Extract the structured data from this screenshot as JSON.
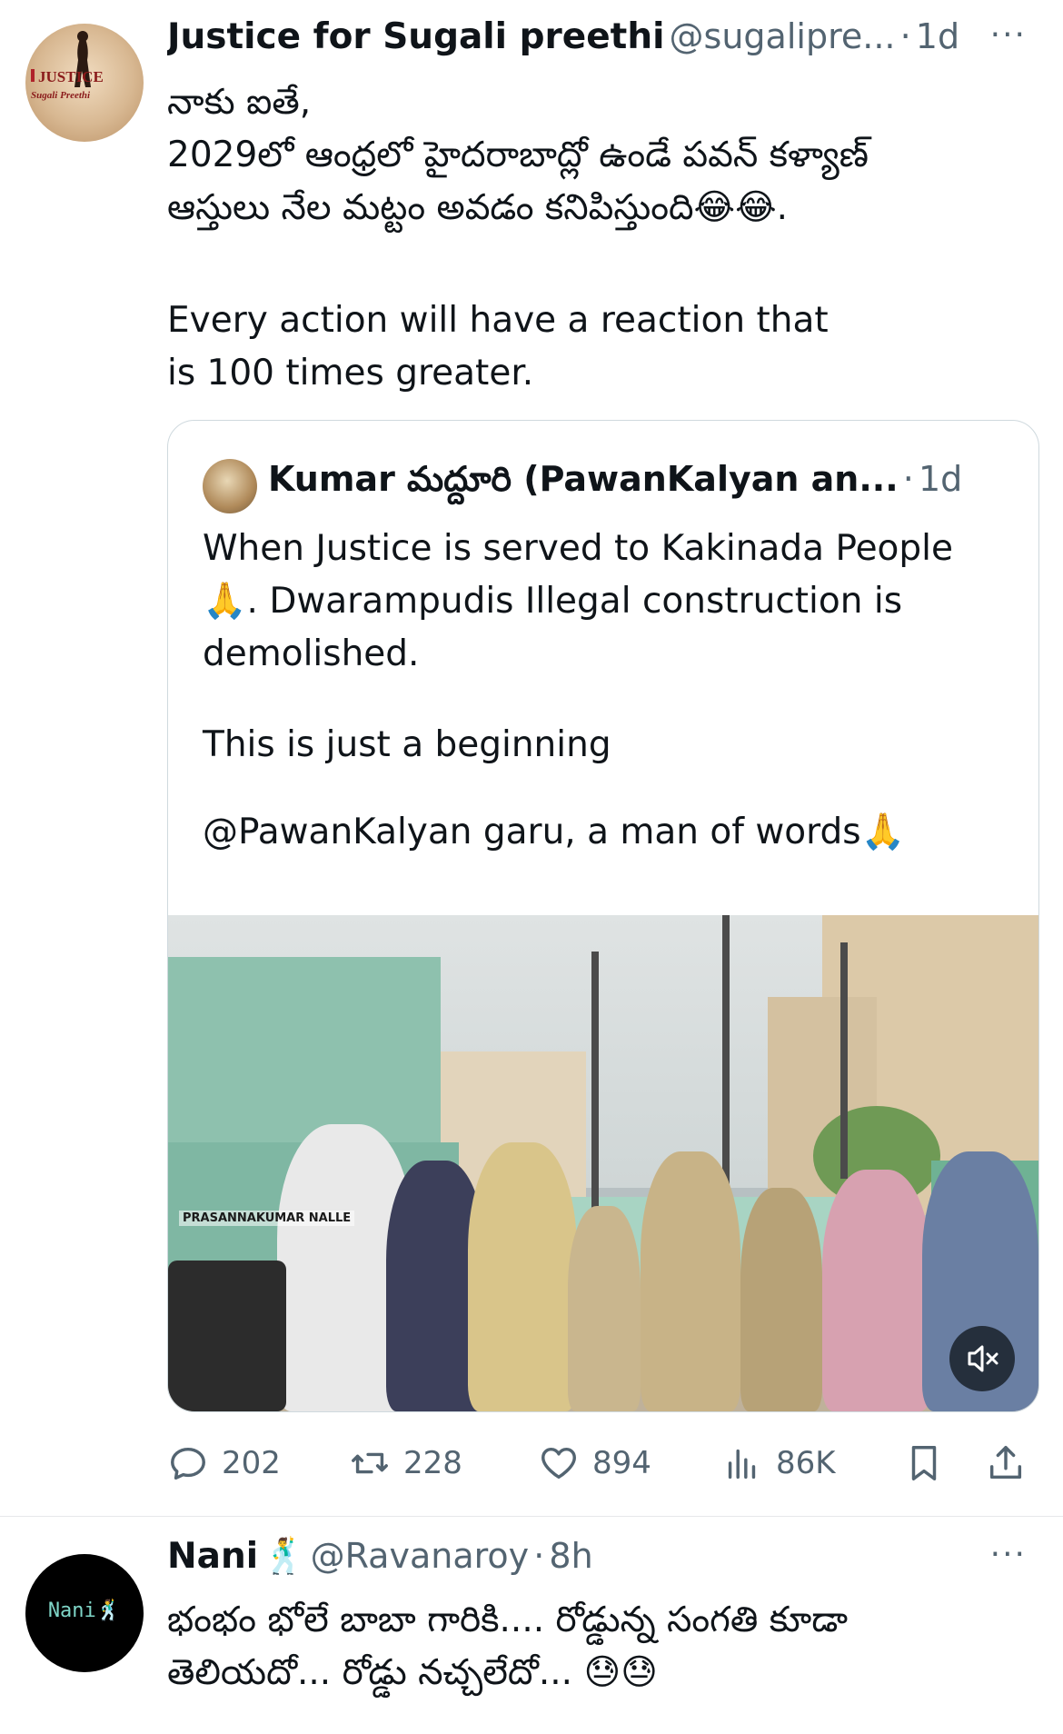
{
  "tweet1": {
    "avatar_text_line1": "JUSTICE",
    "avatar_text_line2": "Sugali Preethi",
    "name": "Justice for Sugali preethi",
    "handle": "@sugalipre...",
    "separator": "·",
    "time": "1d",
    "more_label": "···",
    "text_lines": [
      "నాకు ఐతే,",
      "2029లో ఆంధ్రలో హైదరాబాద్లో ఉండే పవన్ కళ్యాణ్",
      "ఆస్తులు నేల మట్టం అవడం కనిపిస్తుంది😂😂."
    ],
    "text_en": "Every action will have a reaction that is 100 times greater.",
    "quote": {
      "name": "Kumar మద్దూరి (PawanKalyan an...",
      "separator": "·",
      "time": "1d",
      "para1": "When Justice is served to Kakinada People 🙏. Dwarampudis Illegal construction is demolished.",
      "para2": "This is just a beginning",
      "para3": "@PawanKalyan garu, a man of words🙏",
      "video_watermark": "PRASANNAKUMAR NALLE"
    },
    "actions": {
      "replies": "202",
      "reposts": "228",
      "likes": "894",
      "views": "86K"
    }
  },
  "tweet2": {
    "avatar_text": "Nani🕺",
    "name": "Nani",
    "name_emoji": "🕺",
    "handle": "@Ravanaroy",
    "separator": "·",
    "time": "8h",
    "more_label": "···",
    "text_lines": [
      "భంభం భోలే బాబా గారికి.... రోడ్డున్న సంగతి కూడా",
      "తెలియదో... రోడ్డు నచ్చలేదో... 😓😓"
    ]
  },
  "colors": {
    "text_primary": "#0f1419",
    "text_secondary": "#536471",
    "border": "#cfd9de"
  }
}
